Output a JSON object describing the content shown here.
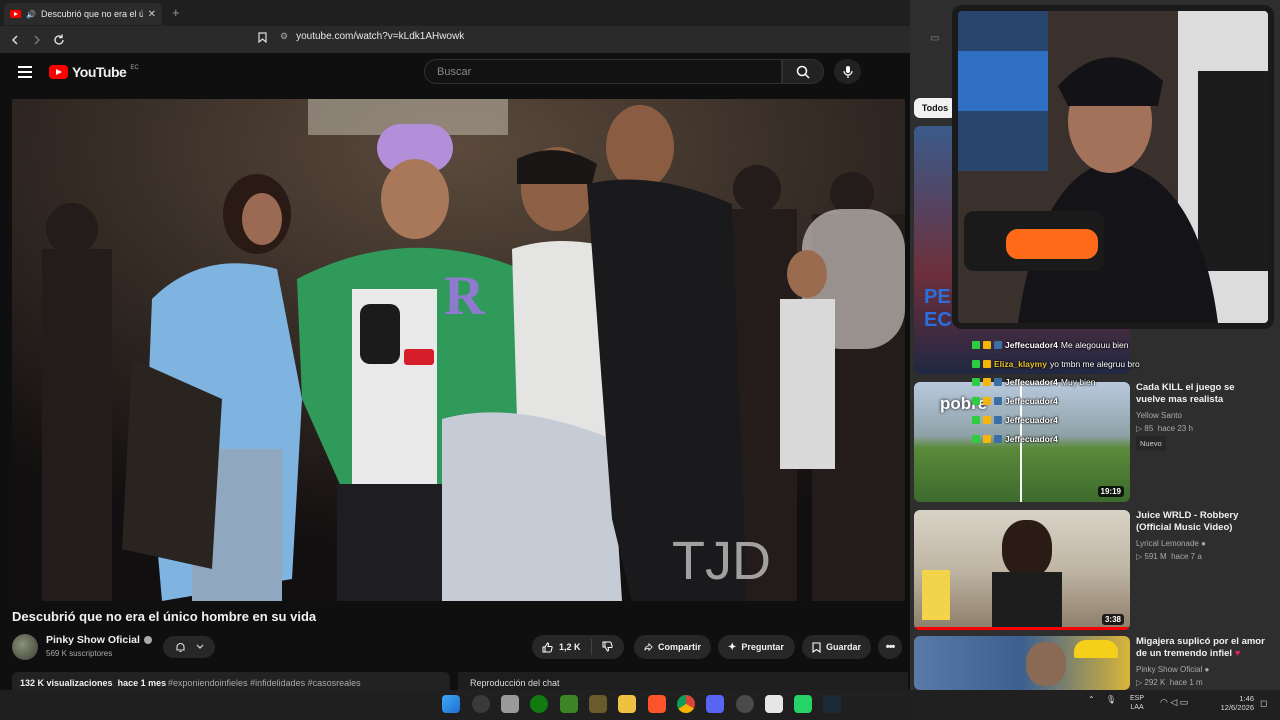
{
  "browser": {
    "tab_title": "Descubrió que no era el únic",
    "tab_close": "✕",
    "new_tab": "+",
    "url": "youtube.com/watch?v=kLdk1AHwowk"
  },
  "header": {
    "logo_text": "YouTube",
    "region": "EC",
    "search_placeholder": "Buscar"
  },
  "video": {
    "title": "Descubrió que no era el único hombre en su vida",
    "channel": "Pinky Show Oficial",
    "subscribers": "569 K suscriptores",
    "likes": "1,2 K",
    "share_label": "Compartir",
    "ask_label": "Preguntar",
    "save_label": "Guardar",
    "views": "132 K visualizaciones",
    "age": "hace 1 mes",
    "hashtags": "#exponiendoinfieles #infidelidades #casosreales",
    "chat_replay": "Reproducción del chat"
  },
  "sidebar": {
    "chip_all": "Todos",
    "items": [
      {
        "title": "Cada KILL el juego se vuelve mas realista",
        "channel": "Yellow Santo",
        "views": "85",
        "age": "hace 23 h",
        "badge": "Nuevo",
        "duration": "19:19",
        "overlay_text": "pobre"
      },
      {
        "title": "Juice WRLD - Robbery (Official Music Video)",
        "channel": "Lyrical Lemonade",
        "views": "591 M",
        "age": "hace 7 a",
        "duration": "3:38"
      },
      {
        "title": "Migajera suplicó por el amor de un tremendo infiel",
        "channel": "Pinky Show Oficial",
        "views": "292 K",
        "age": "hace 1 m"
      }
    ]
  },
  "chat_overlay": [
    {
      "user": "Jeffecuador4",
      "message": "Me alegouuu bien",
      "color": "#ffffff"
    },
    {
      "user": "Eliza_klaymy",
      "message": "yo tmbn me alegruu bro",
      "color": "#e8c12a"
    },
    {
      "user": "Jeffecuador4",
      "message": "Muy bien",
      "color": "#ffffff"
    },
    {
      "user": "Jeffecuador4",
      "message": "",
      "color": "#ffffff"
    },
    {
      "user": "Jeffecuador4",
      "message": "",
      "color": "#ffffff"
    },
    {
      "user": "Jeffecuador4",
      "message": "",
      "color": "#ffffff"
    }
  ],
  "taskbar": {
    "lang_top": "ESP",
    "lang_bottom": "LAA",
    "time": "1:46",
    "date": "12/6/2026"
  },
  "colors": {
    "youtube_red": "#ff0000",
    "background": "#0f0f0f",
    "sidebar_bg": "#2e2e2e"
  }
}
